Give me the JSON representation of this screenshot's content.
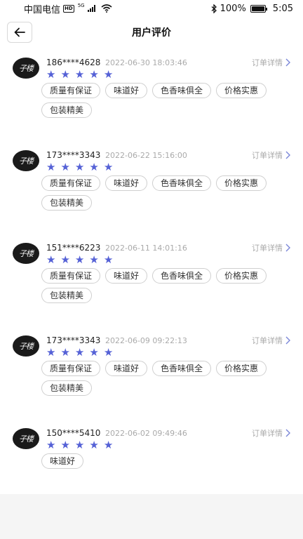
{
  "status_bar": {
    "carrier": "中国电信",
    "hd": "HD",
    "network": "5G",
    "battery": "100%",
    "battery_level": 1.0,
    "time": "5:05"
  },
  "header": {
    "title": "用户评价",
    "back_icon": "arrow-left-icon"
  },
  "colors": {
    "star": "#5561d6",
    "accent_chevron": "#7a86d8",
    "muted_text": "#aaaaaa"
  },
  "reviews": [
    {
      "avatar_text": "子楼",
      "user": "186****4628",
      "date": "2022-06-30 18:03:46",
      "order_link": "订单详情",
      "rating": 5,
      "tags": [
        "质量有保证",
        "味道好",
        "色香味俱全",
        "价格实惠",
        "包装精美"
      ]
    },
    {
      "avatar_text": "子楼",
      "user": "173****3343",
      "date": "2022-06-22 15:16:00",
      "order_link": "订单详情",
      "rating": 5,
      "tags": [
        "质量有保证",
        "味道好",
        "色香味俱全",
        "价格实惠",
        "包装精美"
      ]
    },
    {
      "avatar_text": "子楼",
      "user": "151****6223",
      "date": "2022-06-11 14:01:16",
      "order_link": "订单详情",
      "rating": 5,
      "tags": [
        "质量有保证",
        "味道好",
        "色香味俱全",
        "价格实惠",
        "包装精美"
      ]
    },
    {
      "avatar_text": "子楼",
      "user": "173****3343",
      "date": "2022-06-09 09:22:13",
      "order_link": "订单详情",
      "rating": 5,
      "tags": [
        "质量有保证",
        "味道好",
        "色香味俱全",
        "价格实惠",
        "包装精美"
      ]
    },
    {
      "avatar_text": "子楼",
      "user": "150****5410",
      "date": "2022-06-02 09:49:46",
      "order_link": "订单详情",
      "rating": 5,
      "tags": [
        "味道好"
      ]
    }
  ]
}
